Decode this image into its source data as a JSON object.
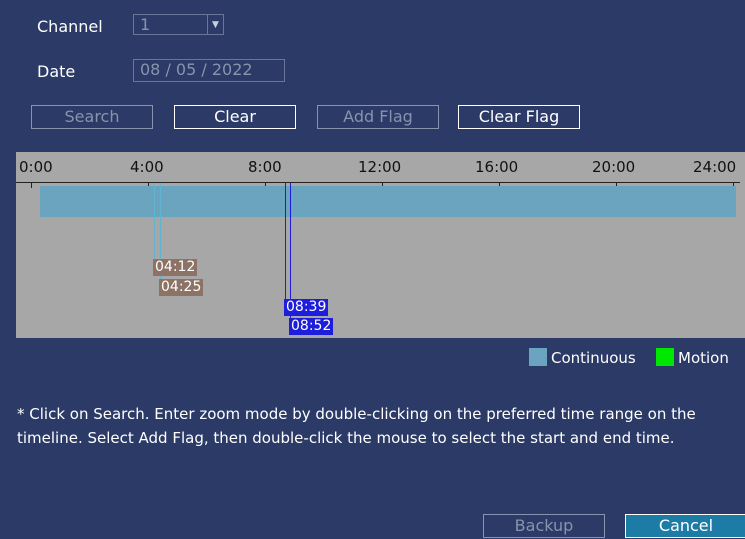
{
  "form": {
    "channel_label": "Channel",
    "channel_value": "1",
    "date_label": "Date",
    "date_value": "08 / 05 / 2022"
  },
  "actions": {
    "search": "Search",
    "clear": "Clear",
    "add_flag": "Add Flag",
    "clear_flag": "Clear Flag"
  },
  "timeline": {
    "ticks": [
      "0:00",
      "4:00",
      "8:00",
      "12:00",
      "16:00",
      "20:00",
      "24:00"
    ],
    "flags": [
      {
        "start": "04:12",
        "end": "04:25",
        "color": "#8d7366",
        "line_color": "#5fb5cf"
      },
      {
        "start": "08:39",
        "end": "08:52",
        "color": "#1d1ddb",
        "line_color": "#1d1ddb"
      }
    ],
    "continuous_color": "#6aa4be"
  },
  "legend": {
    "continuous_label": "Continuous",
    "continuous_color": "#6aa4be",
    "motion_label": "Motion",
    "motion_color": "#00e800"
  },
  "note": "* Click on Search. Enter zoom mode by double-clicking on the preferred time range on the timeline. Select Add Flag, then double-click the mouse to select the start and end time.",
  "footer": {
    "backup": "Backup",
    "cancel": "Cancel"
  }
}
